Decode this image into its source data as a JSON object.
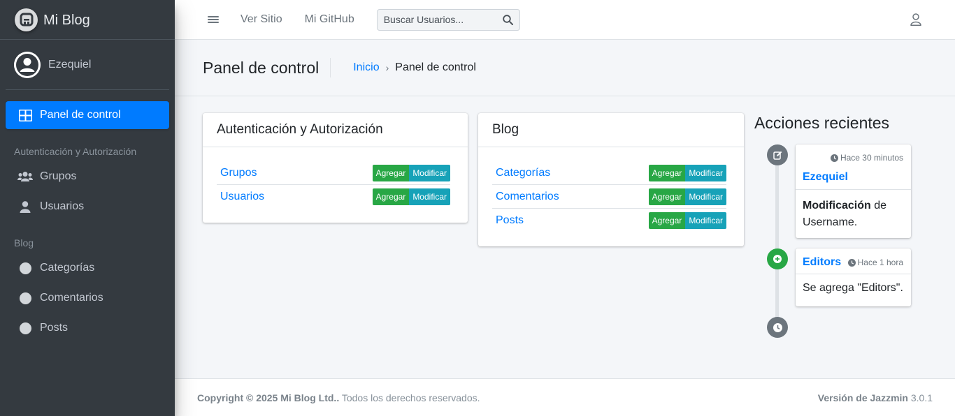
{
  "brand": {
    "name": "Mi Blog"
  },
  "user": {
    "name": "Ezequiel"
  },
  "sidebar": {
    "dashboard_label": "Panel de control",
    "sections": [
      {
        "header": "Autenticación y Autorización",
        "items": [
          "Grupos",
          "Usuarios"
        ]
      },
      {
        "header": "Blog",
        "items": [
          "Categorías",
          "Comentarios",
          "Posts"
        ]
      }
    ]
  },
  "topbar": {
    "links": [
      "Ver Sitio",
      "Mi GitHub"
    ],
    "search_placeholder": "Buscar Usuarios..."
  },
  "header": {
    "title": "Panel de control",
    "breadcrumb_home": "Inicio",
    "breadcrumb_separator": "›",
    "breadcrumb_current": "Panel de control"
  },
  "apps": [
    {
      "title": "Autenticación y Autorización",
      "models": [
        "Grupos",
        "Usuarios"
      ]
    },
    {
      "title": "Blog",
      "models": [
        "Categorías",
        "Comentarios",
        "Posts"
      ]
    }
  ],
  "buttons": {
    "add": "Agregar",
    "change": "Modificar"
  },
  "recent": {
    "title": "Acciones recientes",
    "items": [
      {
        "time": "Hace 30 minutos",
        "object": "Ezequiel",
        "action_strong": "Modificación",
        "action_rest": " de Username."
      },
      {
        "time": "Hace 1 hora",
        "object": "Editors",
        "action_text": "Se agrega \"Editors\"."
      }
    ]
  },
  "footer": {
    "copyright_strong": "Copyright © 2025 Mi Blog Ltd..",
    "copyright_rest": " Todos los derechos reservados.",
    "version_strong": "Versión de Jazzmin",
    "version_num": " 3.0.1"
  },
  "colors": {
    "primary": "#007bff",
    "success": "#28a745",
    "info": "#17a2b8",
    "sidebar": "#343a40"
  }
}
